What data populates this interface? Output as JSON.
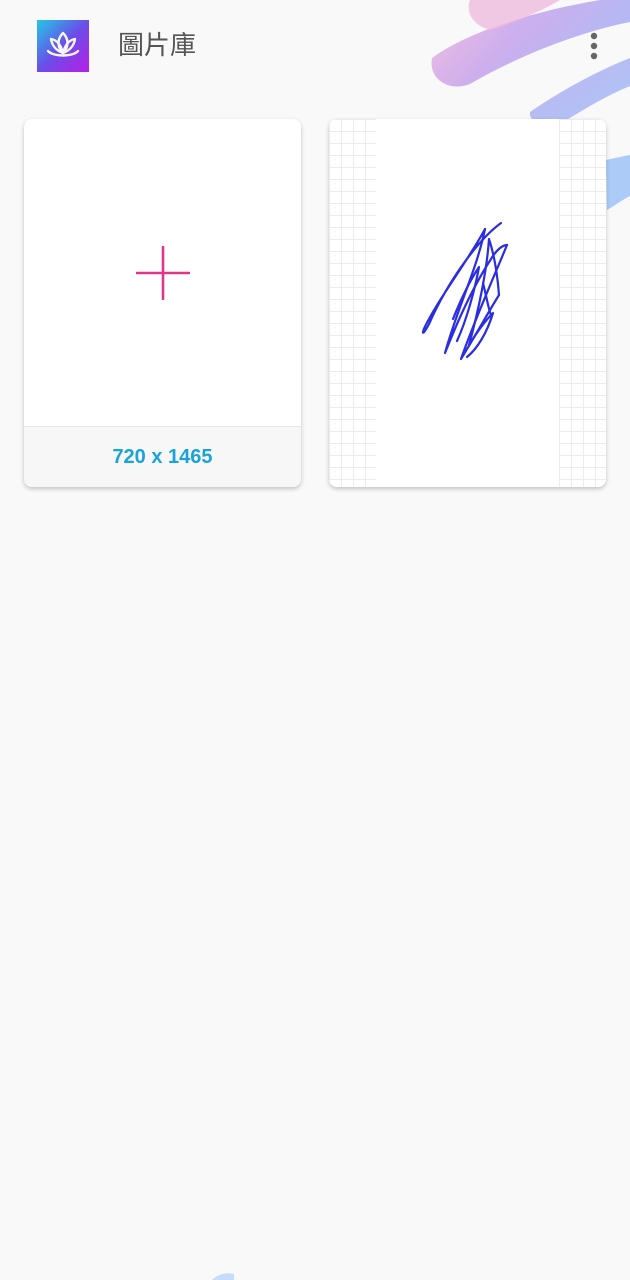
{
  "header": {
    "title": "圖片庫",
    "logo_icon": "lotus-icon",
    "menu_icon": "more-vertical-icon"
  },
  "gallery": {
    "new_card": {
      "icon": "plus-icon",
      "size_label": "720 x 1465"
    },
    "drawing_card": {
      "content": "blue-pen-scribble"
    }
  },
  "colors": {
    "background": "#f9f9f9",
    "plus": "#e0358c",
    "size_label": "#1aa3d9",
    "title": "#555555",
    "scribble": "#2a2de0",
    "logo_gradient": [
      "#22c8e6",
      "#6a4ee8",
      "#b81ee8"
    ]
  }
}
